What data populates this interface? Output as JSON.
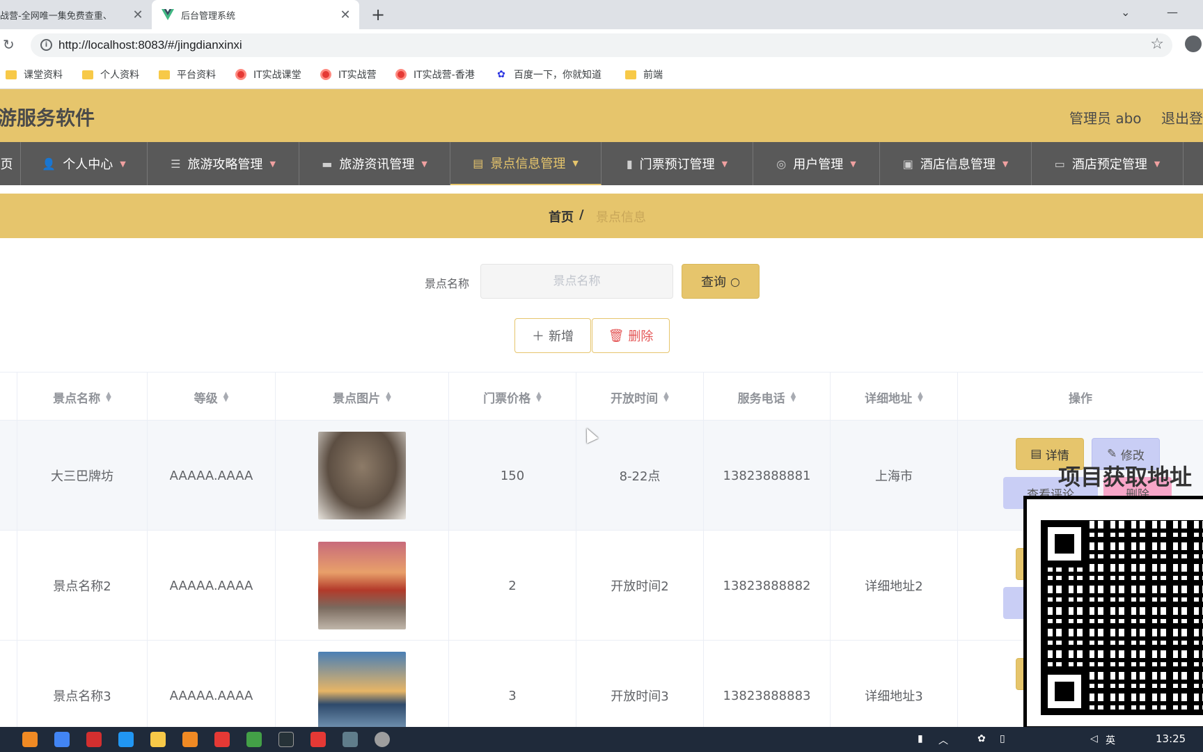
{
  "browser": {
    "tabs": [
      {
        "title": "战营-全网唯一集免费查重、",
        "close": "✕"
      },
      {
        "title": "后台管理系统",
        "close": "✕"
      }
    ],
    "new_tab": "+",
    "url": "http://localhost:8083/#/jingdianxinxi",
    "bookmarks": [
      "课堂资料",
      "个人资料",
      "平台资料",
      "IT实战课堂",
      "IT实战营",
      "IT实战营-香港",
      "百度一下，你就知道",
      "前端"
    ]
  },
  "app": {
    "title": "游服务软件",
    "admin_label": "管理员 abo",
    "logout_label": "退出登"
  },
  "nav": {
    "items": [
      {
        "label": "页",
        "icon": "home-icon"
      },
      {
        "label": "个人中心",
        "icon": "user-icon"
      },
      {
        "label": "旅游攻略管理",
        "icon": "list-icon"
      },
      {
        "label": "旅游资讯管理",
        "icon": "monitor-icon"
      },
      {
        "label": "景点信息管理",
        "icon": "clipboard-icon",
        "active": true
      },
      {
        "label": "门票预订管理",
        "icon": "bar-chart-icon"
      },
      {
        "label": "用户管理",
        "icon": "compass-icon"
      },
      {
        "label": "酒店信息管理",
        "icon": "suitcase-icon"
      },
      {
        "label": "酒店预定管理",
        "icon": "chat-icon"
      }
    ]
  },
  "breadcrumb": {
    "home": "首页",
    "separator": "/",
    "current": "景点信息"
  },
  "search": {
    "label": "景点名称",
    "placeholder": "景点名称",
    "button": "查询"
  },
  "actions": {
    "add": "新增",
    "delete": "删除"
  },
  "table": {
    "columns": [
      "景点名称",
      "等级",
      "景点图片",
      "门票价格",
      "开放时间",
      "服务电话",
      "详细地址",
      "操作"
    ],
    "rows": [
      {
        "name": "大三巴牌坊",
        "level": "AAAAA.AAAA",
        "price": "150",
        "hours": "8-22点",
        "phone": "13823888881",
        "address": "上海市"
      },
      {
        "name": "景点名称2",
        "level": "AAAAA.AAAA",
        "price": "2",
        "hours": "开放时间2",
        "phone": "13823888882",
        "address": "详细地址2"
      },
      {
        "name": "景点名称3",
        "level": "AAAAA.AAAA",
        "price": "3",
        "hours": "开放时间3",
        "phone": "13823888883",
        "address": "详细地址3"
      }
    ],
    "row_actions": {
      "detail": "详情",
      "edit": "修改",
      "comments": "查看评论",
      "delete": "删除"
    }
  },
  "overlay": {
    "qr_title": "项目获取地址"
  },
  "taskbar": {
    "time": "13:25",
    "ime": "英"
  },
  "colors": {
    "accent": "#e6c56c",
    "nav_bg": "#595959",
    "danger": "#e45656"
  }
}
